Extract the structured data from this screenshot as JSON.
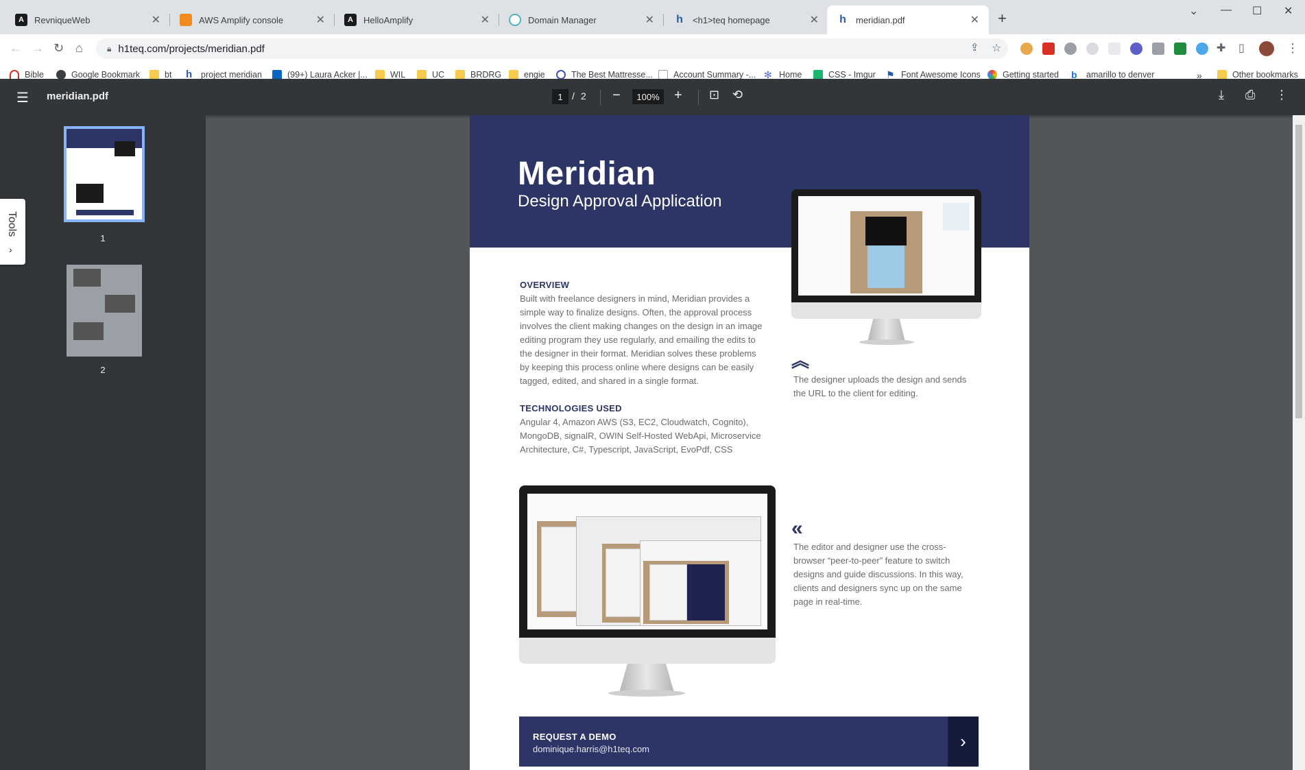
{
  "tabs": [
    {
      "title": "RevniqueWeb",
      "icon": "angular-icon"
    },
    {
      "title": "AWS Amplify console",
      "icon": "aws-amplify-icon"
    },
    {
      "title": "HelloAmplify",
      "icon": "angular-icon"
    },
    {
      "title": "Domain Manager",
      "icon": "domain-manager-icon"
    },
    {
      "title": "<h1>teq homepage",
      "icon": "h1teq-icon"
    },
    {
      "title": "meridian.pdf",
      "icon": "h1teq-icon"
    }
  ],
  "address": {
    "url": "h1teq.com/projects/meridian.pdf"
  },
  "bookmarks": [
    {
      "label": "Bible",
      "icon": "bible-icon"
    },
    {
      "label": "Google Bookmark",
      "icon": "globe-icon"
    },
    {
      "label": "bt",
      "icon": "folder-icon"
    },
    {
      "label": "project meridian",
      "icon": "h1teq-icon"
    },
    {
      "label": "(99+) Laura Acker |...",
      "icon": "linkedin-icon"
    },
    {
      "label": "WIL",
      "icon": "folder-icon"
    },
    {
      "label": "UC",
      "icon": "folder-icon"
    },
    {
      "label": "BRDRG",
      "icon": "folder-icon"
    },
    {
      "label": "engie",
      "icon": "folder-icon"
    },
    {
      "label": "The Best Mattresse...",
      "icon": "mattress-icon"
    },
    {
      "label": "Account Summary -...",
      "icon": "document-icon"
    },
    {
      "label": "Home",
      "icon": "home-snowflake-icon"
    },
    {
      "label": "CSS - Imgur",
      "icon": "imgur-icon"
    },
    {
      "label": "Font Awesome Icons",
      "icon": "flag-icon"
    },
    {
      "label": "Getting started",
      "icon": "getting-started-icon"
    },
    {
      "label": "amarillo to denver",
      "icon": "bing-icon"
    }
  ],
  "bookmarks_overflow": "»",
  "other_bookmarks": "Other bookmarks",
  "pdf": {
    "filename": "meridian.pdf",
    "current_page": "1",
    "page_sep": "/",
    "total_pages": "2",
    "zoom": "100%",
    "thumbnails": [
      "1",
      "2"
    ],
    "tools_label": "Tools"
  },
  "doc": {
    "title": "Meridian",
    "subtitle": "Design Approval Application",
    "overview_heading": "OVERVIEW",
    "overview_lines": [
      "Built with freelance designers in mind, Meridian provides a",
      "simple way to finalize designs. Often, the approval process",
      "involves the client making changes on the design in an image",
      "editing program they use regularly, and emailing the edits to",
      "the designer in their format. Meridian solves these problems",
      "by keeping this process online where designs can be easily",
      "tagged, edited, and shared in a single format."
    ],
    "tech_heading": "TECHNOLOGIES USED",
    "tech_lines": [
      "Angular 4, Amazon AWS (S3, EC2, Cloudwatch, Cognito),",
      "MongoDB, signalR, OWIN Self-Hosted WebApi, Microservice",
      "Architecture, C#, Typescript, JavaScript, EvoPdf, CSS"
    ],
    "caption1_lines": [
      "The designer uploads the design and sends",
      "the URL to the client for editing."
    ],
    "caption2_lines": [
      "The editor and designer use the cross-",
      "browser “peer-to-peer” feature to switch",
      "designs and guide discussions. In this way,",
      "clients and designers sync up on the same",
      "page in real-time."
    ],
    "cta_heading": "REQUEST A DEMO",
    "cta_email": "dominique.harris@h1teq.com"
  },
  "colors": {
    "brand_navy": "#2c3566",
    "viewer_toolbar": "#323639",
    "viewer_bg": "#525659"
  }
}
